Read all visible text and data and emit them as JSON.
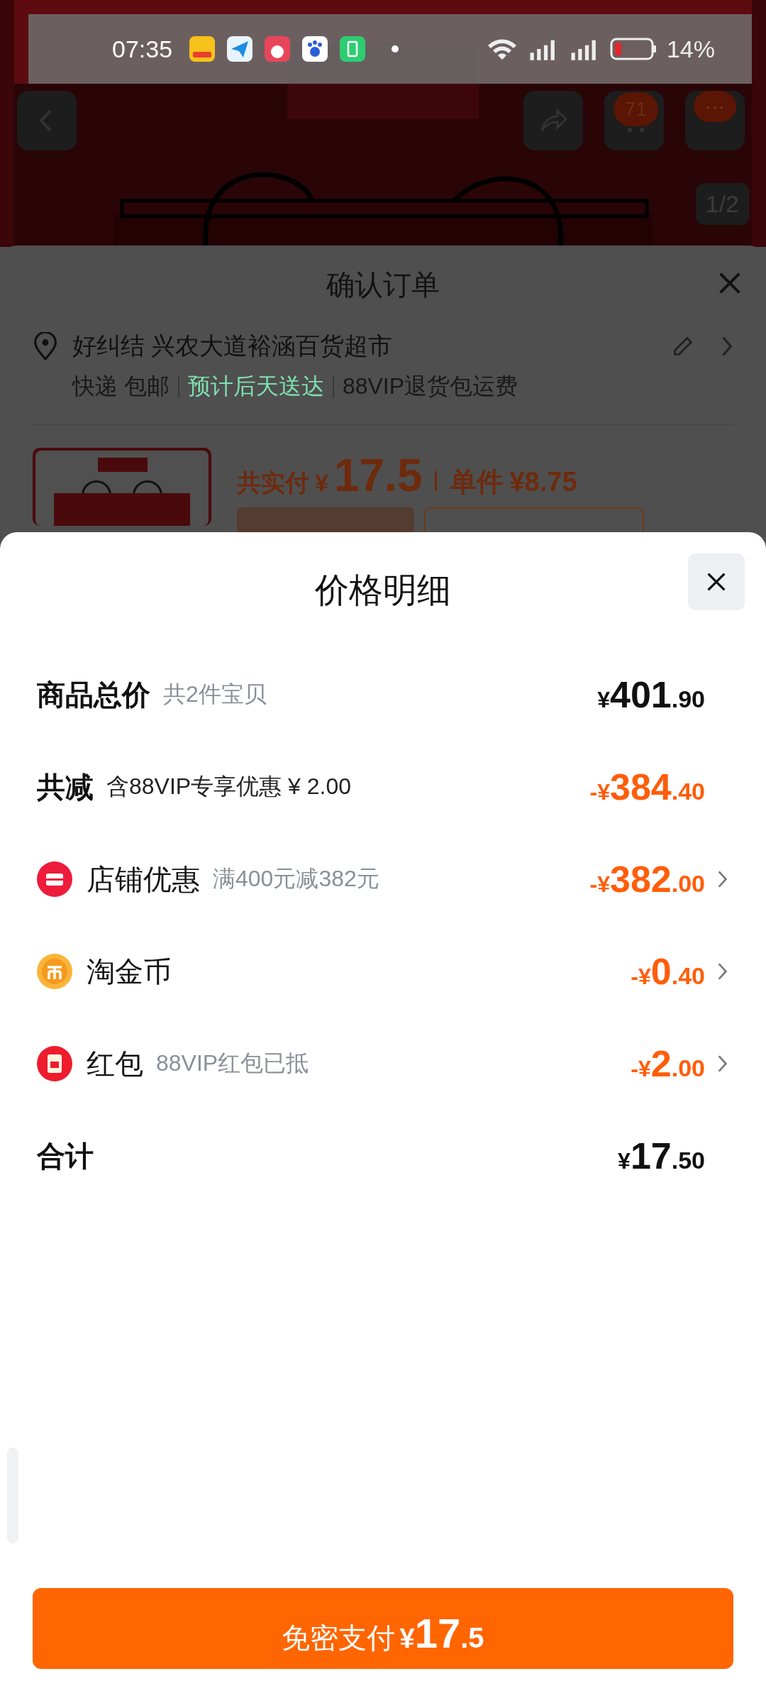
{
  "status_bar": {
    "time": "07:35",
    "battery": "14%"
  },
  "product_page": {
    "cart_count": "71",
    "more": "···",
    "image_counter": "1/2"
  },
  "order_sheet": {
    "title": "确认订单",
    "address": "好纠结 兴农大道裕涵百货超市",
    "delivery": [
      {
        "text": "快递 包邮",
        "kind": "plain"
      },
      {
        "text": "预计后天送达",
        "kind": "highlight"
      },
      {
        "text": "88VIP退货包运费",
        "kind": "plain"
      }
    ],
    "paid_label": "共实付",
    "paid_currency": "¥",
    "paid_amount": "17.5",
    "unit_label": "单件",
    "unit_price": "¥8.75"
  },
  "price_sheet": {
    "title": "价格明细",
    "rows": [
      {
        "label": "商品总价",
        "note": "共2件宝贝",
        "kind": "subtotal",
        "prefix": "¥",
        "main": "401",
        "fraction": ".90"
      },
      {
        "label": "共减",
        "note": "含88VIP专享优惠 ¥ 2.00",
        "kind": "reduction",
        "prefix": "-¥",
        "main": "384",
        "fraction": ".40"
      },
      {
        "label": "店铺优惠",
        "note": "满400元减382元",
        "kind": "store",
        "prefix": "-¥",
        "main": "382",
        "fraction": ".00"
      },
      {
        "label": "淘金币",
        "kind": "coin",
        "prefix": "-¥",
        "main": "0",
        "fraction": ".40"
      },
      {
        "label": "红包",
        "note": "88VIP红包已抵",
        "kind": "packet",
        "prefix": "-¥",
        "main": "2",
        "fraction": ".00"
      },
      {
        "label": "合计",
        "kind": "sum",
        "prefix": "¥",
        "main": "17",
        "fraction": ".50"
      }
    ],
    "pay_button": {
      "label": "免密支付",
      "currency": "¥",
      "main": "17",
      "fraction": ".5"
    }
  }
}
